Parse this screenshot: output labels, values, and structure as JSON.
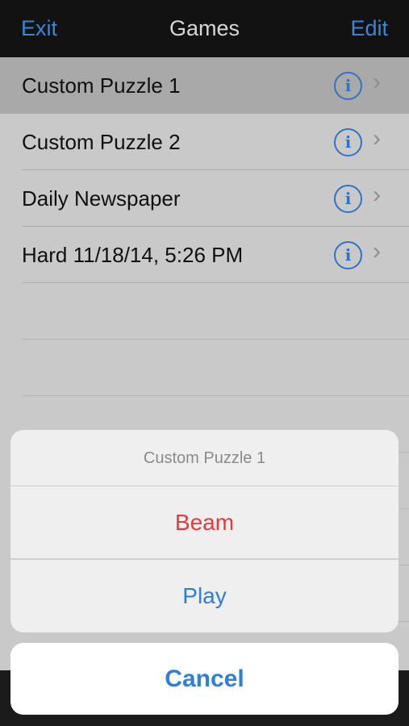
{
  "navbar": {
    "title": "Games",
    "left_button": "Exit",
    "right_button": "Edit"
  },
  "games": [
    {
      "label": "Custom Puzzle 1",
      "info_glyph": "i",
      "chevron_glyph": "›",
      "selected": true
    },
    {
      "label": "Custom Puzzle 2",
      "info_glyph": "i",
      "chevron_glyph": "›"
    },
    {
      "label": "Daily Newspaper",
      "info_glyph": "i",
      "chevron_glyph": "›"
    },
    {
      "label": "Hard 11/18/14, 5:26 PM",
      "info_glyph": "i",
      "chevron_glyph": "›"
    }
  ],
  "action_sheet": {
    "title": "Custom Puzzle 1",
    "actions": [
      {
        "label": "Beam",
        "style": "destructive"
      },
      {
        "label": "Play",
        "style": "default"
      }
    ],
    "cancel": "Cancel"
  },
  "colors": {
    "accent": "#2f7fd6",
    "destructive": "#e23b3b",
    "navbar": "#121212"
  }
}
